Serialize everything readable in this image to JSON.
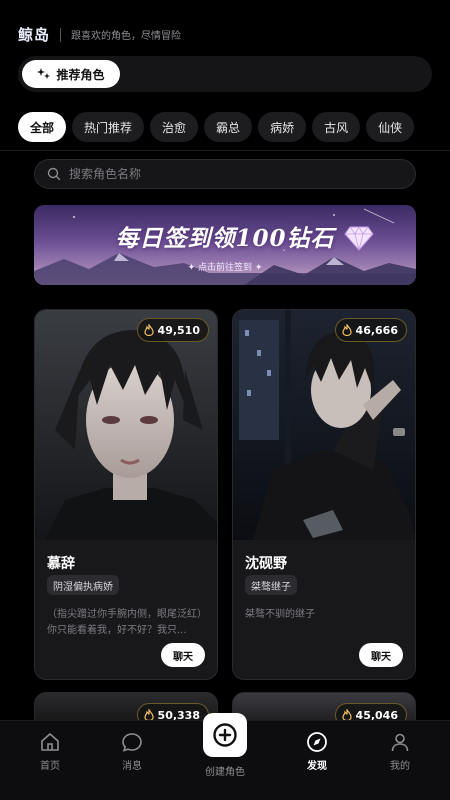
{
  "header": {
    "brand": "鲸岛",
    "slogan": "跟喜欢的角色，尽情冒险",
    "recommend_label": "推荐角色"
  },
  "tabs": [
    {
      "label": "全部",
      "active": true
    },
    {
      "label": "热门推荐",
      "active": false
    },
    {
      "label": "治愈",
      "active": false
    },
    {
      "label": "霸总",
      "active": false
    },
    {
      "label": "病娇",
      "active": false
    },
    {
      "label": "古风",
      "active": false
    },
    {
      "label": "仙侠",
      "active": false
    }
  ],
  "search": {
    "placeholder": "搜索角色名称"
  },
  "banner": {
    "title": "每日签到领100钻石",
    "subtitle": "点击前往签到"
  },
  "cards": [
    {
      "heat": "49,510",
      "name": "慕辞",
      "tag": "阴湿偏执病娇",
      "desc": "（指尖蹭过你手腕内侧，眼尾泛红）你只能看着我，好不好？我只...",
      "chat_label": "聊天"
    },
    {
      "heat": "46,666",
      "name": "沈砚野",
      "tag": "桀骜继子",
      "desc": "桀骜不驯的继子",
      "chat_label": "聊天"
    }
  ],
  "peek_cards": [
    {
      "heat": "50,338"
    },
    {
      "heat": "45,046"
    }
  ],
  "tabbar": {
    "home": "首页",
    "messages": "消息",
    "create": "创建角色",
    "discover": "发现",
    "mine": "我的",
    "active": "discover"
  },
  "colors": {
    "background": "#000000",
    "accent": "#ffffff",
    "heat_border": "#6a5a2a"
  }
}
